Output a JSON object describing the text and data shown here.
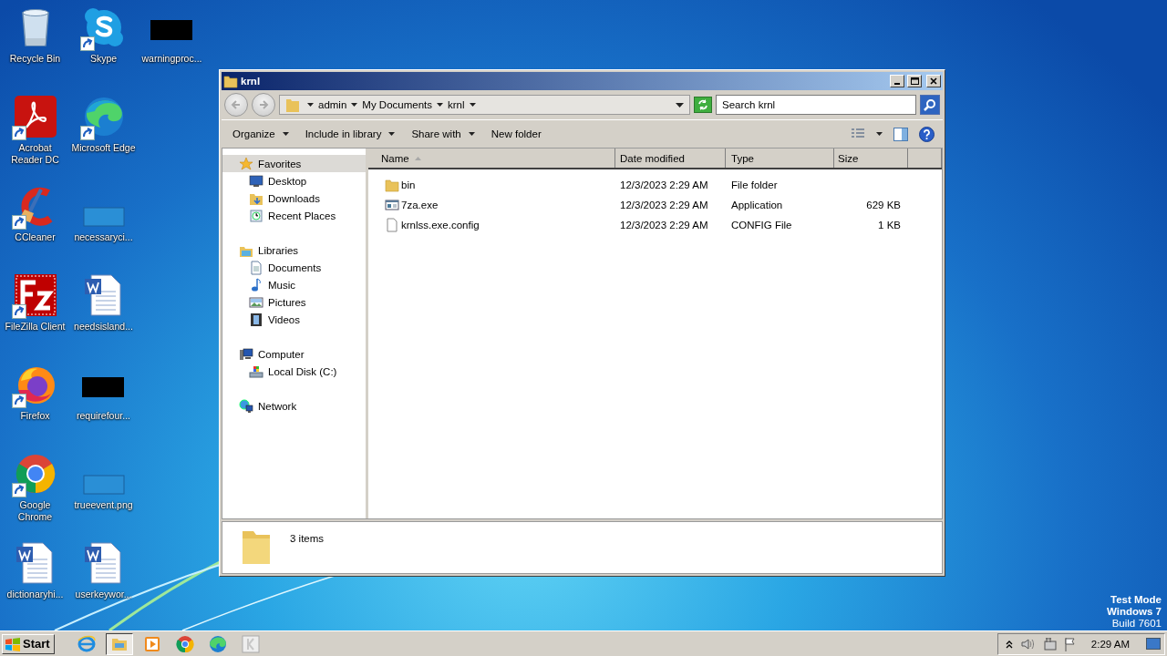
{
  "desktop": {
    "icons": [
      {
        "label": "Recycle Bin",
        "kind": "recycle",
        "shortcut": false
      },
      {
        "label": "Acrobat Reader DC",
        "kind": "acrobat",
        "shortcut": true
      },
      {
        "label": "CCleaner",
        "kind": "ccleaner",
        "shortcut": true
      },
      {
        "label": "FileZilla Client",
        "kind": "filezilla",
        "shortcut": true
      },
      {
        "label": "Firefox",
        "kind": "firefox",
        "shortcut": true
      },
      {
        "label": "Google Chrome",
        "kind": "chrome",
        "shortcut": true
      },
      {
        "label": "dictionaryhi...",
        "kind": "word",
        "shortcut": false
      },
      {
        "label": "Skype",
        "kind": "skype",
        "shortcut": true
      },
      {
        "label": "Microsoft Edge",
        "kind": "edge",
        "shortcut": true
      },
      {
        "label": "necessaryci...",
        "kind": "blank",
        "shortcut": false
      },
      {
        "label": "needsisland...",
        "kind": "word",
        "shortcut": false
      },
      {
        "label": "requirefour...",
        "kind": "dark",
        "shortcut": false
      },
      {
        "label": "trueevent.png",
        "kind": "blank",
        "shortcut": false
      },
      {
        "label": "userkeywor...",
        "kind": "word",
        "shortcut": false
      },
      {
        "label": "warningproc...",
        "kind": "dark",
        "shortcut": false
      }
    ],
    "notice": [
      {
        "text": "Test Mode",
        "bold": true
      },
      {
        "text": "Windows 7",
        "bold": true
      },
      {
        "text": "Build 7601",
        "bold": false
      }
    ]
  },
  "window": {
    "title": "krnl",
    "breadcrumb": [
      "admin",
      "My Documents",
      "krnl"
    ],
    "search": {
      "placeholder": "Search krnl"
    },
    "toolbar": [
      {
        "label": "Organize",
        "dropdown": true
      },
      {
        "label": "Include in library",
        "dropdown": true
      },
      {
        "label": "Share with",
        "dropdown": true
      },
      {
        "label": "New folder",
        "dropdown": false
      }
    ],
    "nav": [
      {
        "label": "Favorites",
        "kind": "star",
        "selected": true,
        "children": [
          {
            "label": "Desktop",
            "kind": "desktop",
            "selected": false
          },
          {
            "label": "Downloads",
            "kind": "downloads",
            "selected": false
          },
          {
            "label": "Recent Places",
            "kind": "recent",
            "selected": false
          }
        ]
      },
      {
        "label": "Libraries",
        "kind": "libraries",
        "selected": false,
        "children": [
          {
            "label": "Documents",
            "kind": "documents",
            "selected": false
          },
          {
            "label": "Music",
            "kind": "music",
            "selected": false
          },
          {
            "label": "Pictures",
            "kind": "pictures",
            "selected": false
          },
          {
            "label": "Videos",
            "kind": "videos",
            "selected": false
          }
        ]
      },
      {
        "label": "Computer",
        "kind": "computer",
        "selected": false,
        "children": [
          {
            "label": "Local Disk (C:)",
            "kind": "disk",
            "selected": false
          }
        ]
      },
      {
        "label": "Network",
        "kind": "network",
        "selected": false
      }
    ],
    "columns": [
      {
        "label": "Name",
        "sorted": true
      },
      {
        "label": "Date modified",
        "sorted": false
      },
      {
        "label": "Type",
        "sorted": false
      },
      {
        "label": "Size",
        "sorted": false
      }
    ],
    "files": [
      {
        "name": "bin",
        "kind": "folder",
        "date": "12/3/2023 2:29 AM",
        "type": "File folder"
      },
      {
        "name": "7za.exe",
        "kind": "application",
        "date": "12/3/2023 2:29 AM",
        "type": "Application",
        "size": "629 KB"
      },
      {
        "name": "krnlss.exe.config",
        "kind": "file",
        "date": "12/3/2023 2:29 AM",
        "type": "CONFIG File",
        "size": "1 KB"
      }
    ],
    "status": {
      "count": "3 items"
    }
  },
  "taskbar": {
    "start": "Start",
    "apps": [
      {
        "kind": "ie",
        "selected": false
      },
      {
        "kind": "explorer",
        "selected": true
      },
      {
        "kind": "media",
        "selected": false
      },
      {
        "kind": "chrome",
        "selected": false
      },
      {
        "kind": "edge",
        "selected": false
      },
      {
        "kind": "app",
        "selected": false
      }
    ],
    "clock": "2:29 AM"
  }
}
